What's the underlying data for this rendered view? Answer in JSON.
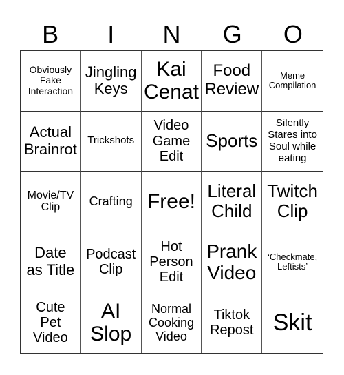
{
  "title_letters": [
    "B",
    "I",
    "N",
    "G",
    "O"
  ],
  "cells": [
    {
      "text": "Obviously Fake Interaction",
      "lines": [
        "Obviously",
        "Fake",
        "Interaction"
      ]
    },
    {
      "text": "Jingling Keys",
      "lines": [
        "Jingling",
        "Keys"
      ]
    },
    {
      "text": "Kai Cenat",
      "lines": [
        "Kai",
        "Cenat"
      ]
    },
    {
      "text": "Food Review",
      "lines": [
        "Food",
        "Review"
      ]
    },
    {
      "text": "Meme Compilation",
      "lines": [
        "Meme",
        "Compilation"
      ]
    },
    {
      "text": "Actual Brainrot",
      "lines": [
        "Actual",
        "Brainrot"
      ]
    },
    {
      "text": "Trickshots",
      "lines": [
        "Trickshots"
      ]
    },
    {
      "text": "Video Game Edit",
      "lines": [
        "Video",
        "Game",
        "Edit"
      ]
    },
    {
      "text": "Sports",
      "lines": [
        "Sports"
      ]
    },
    {
      "text": "Silently Stares into Soul while eating",
      "lines": [
        "Silently",
        "Stares into",
        "Soul while",
        "eating"
      ]
    },
    {
      "text": "Movie/TV Clip",
      "lines": [
        "Movie/TV",
        "Clip"
      ]
    },
    {
      "text": "Crafting",
      "lines": [
        "Crafting"
      ]
    },
    {
      "text": "Free!",
      "lines": [
        "Free!"
      ],
      "free": true
    },
    {
      "text": "Literal Child",
      "lines": [
        "Literal",
        "Child"
      ]
    },
    {
      "text": "Twitch Clip",
      "lines": [
        "Twitch",
        "Clip"
      ]
    },
    {
      "text": "Date as Title",
      "lines": [
        "Date",
        "as Title"
      ]
    },
    {
      "text": "Podcast Clip",
      "lines": [
        "Podcast",
        "Clip"
      ]
    },
    {
      "text": "Hot Person Edit",
      "lines": [
        "Hot",
        "Person",
        "Edit"
      ]
    },
    {
      "text": "Prank Video",
      "lines": [
        "Prank",
        "Video"
      ]
    },
    {
      "text": "‘Checkmate, Leftists’",
      "lines": [
        "‘Checkmate,",
        "Leftists’"
      ]
    },
    {
      "text": "Cute Pet Video",
      "lines": [
        "Cute",
        "Pet",
        "Video"
      ]
    },
    {
      "text": "AI Slop",
      "lines": [
        "AI",
        "Slop"
      ]
    },
    {
      "text": "Normal Cooking Video",
      "lines": [
        "Normal",
        "Cooking",
        "Video"
      ]
    },
    {
      "text": "Tiktok Repost",
      "lines": [
        "Tiktok",
        "Repost"
      ]
    },
    {
      "text": "Skit",
      "lines": [
        "Skit"
      ]
    }
  ]
}
